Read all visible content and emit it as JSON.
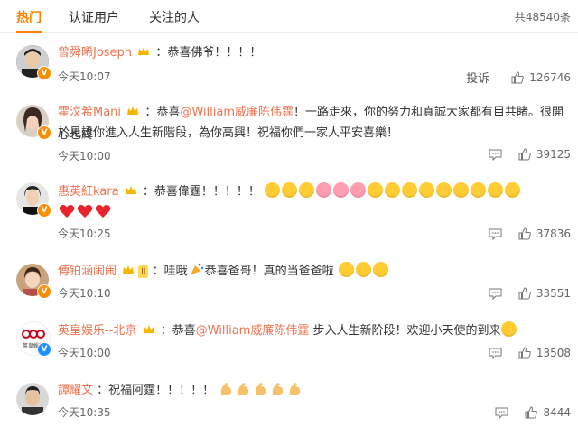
{
  "tabs": [
    {
      "label": "热门"
    },
    {
      "label": "认证用户"
    },
    {
      "label": "关注的人"
    }
  ],
  "total_label": "共48540条",
  "comments": [
    {
      "name": "曾舜晞Joseph",
      "text": "：恭喜佛爷！！！！",
      "time": "今天10:07",
      "likes": "126746",
      "report": "投诉"
    },
    {
      "name": "霍汶希Mani",
      "text_pre": "：恭喜",
      "mention": "@William威廉陈伟霆",
      "text_post": "！一路走來，你的努力和真誠大家都有目共睹。很開心也終",
      "text_line2": "於見證你進入人生新階段，為你高興！祝福你們一家人平安喜樂！",
      "time": "今天10:00",
      "likes": "39125"
    },
    {
      "name": "惠英紅kara",
      "text": "：恭喜偉霆！！！！！",
      "time": "今天10:25",
      "likes": "37836"
    },
    {
      "name": "傅铂涵闹闹",
      "level": "II",
      "text_pre": "：哇哦",
      "text_mid": "恭喜爸哥！真的当爸爸啦",
      "time": "今天10:10",
      "likes": "33551"
    },
    {
      "name": "英皇娱乐--北京",
      "text_pre": "：恭喜",
      "mention": "@William威廉陈伟霆",
      "text_post": " 步入人生新阶段！欢迎小天使的到来",
      "time": "今天10:00",
      "likes": "13508",
      "avatar_text": "英皇娛樂"
    },
    {
      "name": "譚耀文",
      "text": "：祝福阿霆！！！！！",
      "time": "今天10:35",
      "likes": "8444"
    }
  ],
  "colors": {
    "accent": "#ff8200",
    "name": "#eb7350",
    "verified_orange": "#f78f00",
    "verified_blue": "#1e91ff"
  },
  "icons": [
    "crown-icon",
    "reply-icon",
    "like-icon",
    "verified-icon"
  ]
}
